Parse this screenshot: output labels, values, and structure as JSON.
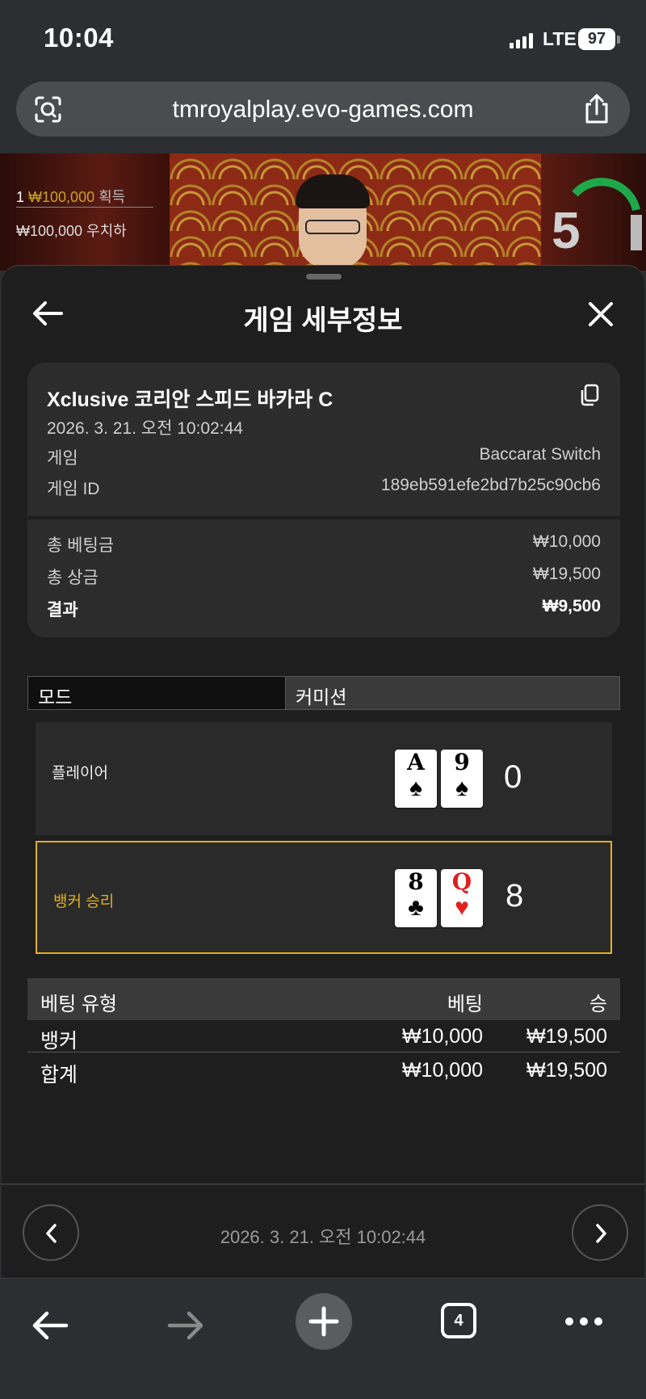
{
  "status_bar": {
    "time": "10:04",
    "network": "LTE",
    "battery": "97"
  },
  "browser": {
    "url": "tmroyalplay.evo-games.com",
    "tabs_count": "4"
  },
  "video": {
    "win_prefix": "1",
    "win_amount": "₩100,000",
    "win_label": "획득",
    "win2": "₩100,000 우치하",
    "timer": "5"
  },
  "sheet": {
    "title": "게임 세부정보",
    "game_name": "Xclusive 코리안 스피드 바카라 C",
    "datetime": "2026. 3. 21. 오전 10:02:44",
    "game_label": "게임",
    "game_value": "Baccarat Switch",
    "game_id_label": "게임 ID",
    "game_id_value": "189eb591efe2bd7b25c90cb6",
    "total_bet_label": "총 베팅금",
    "total_bet_value": "₩10,000",
    "total_win_label": "총 상금",
    "total_win_value": "₩19,500",
    "result_label": "결과",
    "result_value": "₩9,500",
    "mode_label": "모드",
    "mode_value": "커미션",
    "player": {
      "label": "플레이어",
      "cards": [
        {
          "rank": "A",
          "suit": "♠",
          "color": "black"
        },
        {
          "rank": "9",
          "suit": "♠",
          "color": "black"
        }
      ],
      "score": "0"
    },
    "banker": {
      "label": "뱅커 승리",
      "cards": [
        {
          "rank": "8",
          "suit": "♣",
          "color": "black"
        },
        {
          "rank": "Q",
          "suit": "♥",
          "color": "red"
        }
      ],
      "score": "8"
    },
    "bets_table": {
      "headers": [
        "베팅 유형",
        "베팅",
        "승"
      ],
      "rows": [
        [
          "뱅커",
          "₩10,000",
          "₩19,500"
        ],
        [
          "합계",
          "₩10,000",
          "₩19,500"
        ]
      ]
    },
    "nav_datetime": "2026. 3. 21. 오전 10:02:44"
  },
  "colors": {
    "accent_gold": "#e0b020",
    "sheet_bg": "#1e1e1e",
    "card_bg": "#2c2c2c"
  },
  "icons": [
    "scan-icon",
    "share-icon",
    "back-arrow-icon",
    "close-icon",
    "copy-icon",
    "chevron-left-icon",
    "chevron-right-icon",
    "plus-icon",
    "tabs-icon",
    "more-icon"
  ]
}
